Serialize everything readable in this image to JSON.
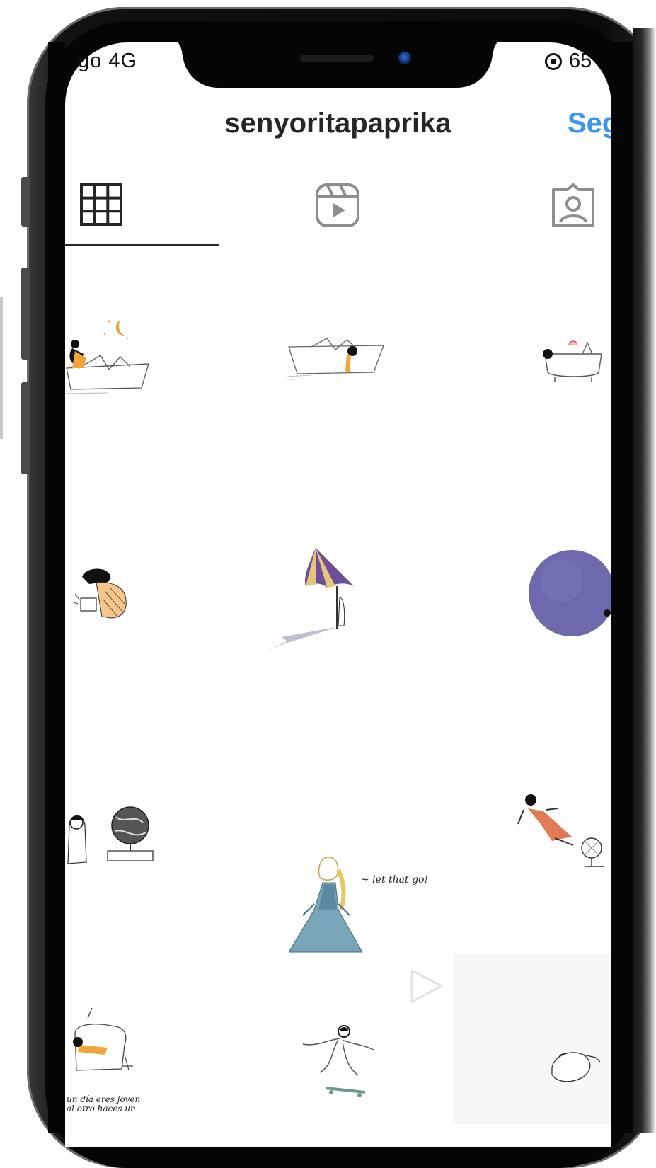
{
  "status_bar": {
    "carrier": "go  4G",
    "battery_text": "65"
  },
  "header": {
    "username": "senyoritapaprika",
    "follow_label": "Seg"
  },
  "tabs": [
    {
      "icon": "grid-icon",
      "selected": true
    },
    {
      "icon": "reels-icon",
      "selected": false
    },
    {
      "icon": "tagged-icon",
      "selected": false
    }
  ],
  "posts": {
    "elsa_caption": "~ let that go!",
    "bottom_left_caption": "un día eres joven\nal otro haces un"
  },
  "colors": {
    "accent": "#3897f0",
    "text": "#262626",
    "purple": "#6c69ad",
    "orange": "#f0a53b"
  }
}
